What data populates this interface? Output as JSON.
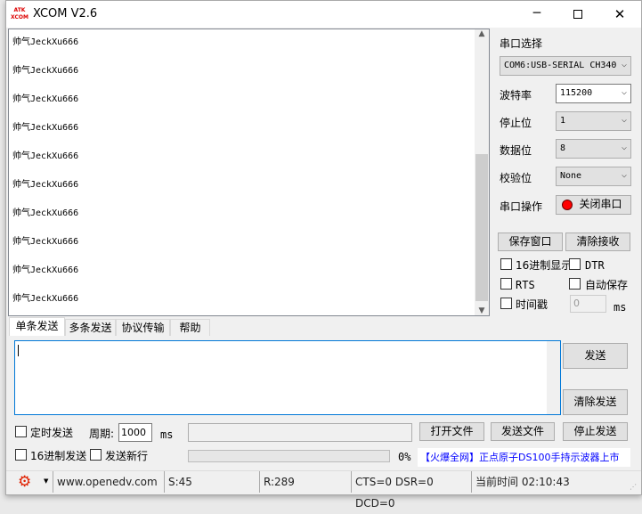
{
  "window": {
    "title": "XCOM V2.6",
    "logo": "ATK XCOM"
  },
  "receive": {
    "lines": [
      "帅气JeckXu666",
      "帅气JeckXu666",
      "帅气JeckXu666",
      "帅气JeckXu666",
      "帅气JeckXu666",
      "帅气JeckXu666",
      "帅气JeckXu666",
      "帅气JeckXu666",
      "帅气JeckXu666",
      "帅气JeckXu666"
    ]
  },
  "panel": {
    "port_select_label": "串口选择",
    "port_value": "COM6:USB-SERIAL CH340",
    "baud_label": "波特率",
    "baud_value": "115200",
    "stop_label": "停止位",
    "stop_value": "1",
    "data_label": "数据位",
    "data_value": "8",
    "parity_label": "校验位",
    "parity_value": "None",
    "op_label": "串口操作",
    "close_port": "关闭串口",
    "save_window": "保存窗口",
    "clear_recv": "清除接收",
    "hex_display": "16进制显示",
    "dtr": "DTR",
    "rts": "RTS",
    "auto_save": "自动保存",
    "timestamp": "时间戳",
    "timestamp_value": "0",
    "ms": "ms"
  },
  "tabs": [
    "单条发送",
    "多条发送",
    "协议传输",
    "帮助"
  ],
  "send": {
    "send_btn": "发送",
    "clear_send": "清除发送",
    "timed_send": "定时发送",
    "period_label": "周期:",
    "period_value": "1000",
    "ms": "ms",
    "open_file": "打开文件",
    "send_file": "发送文件",
    "stop_send": "停止发送",
    "hex_send": "16进制发送",
    "send_newline": "发送新行",
    "progress": "0%",
    "progress_value": 0,
    "ad": "【火爆全网】正点原子DS100手持示波器上市"
  },
  "status": {
    "website": "www.openedv.com",
    "sent": "S:45",
    "recv": "R:289",
    "lines": "CTS=0 DSR=0 DCD=0",
    "time": "当前时间 02:10:43"
  }
}
